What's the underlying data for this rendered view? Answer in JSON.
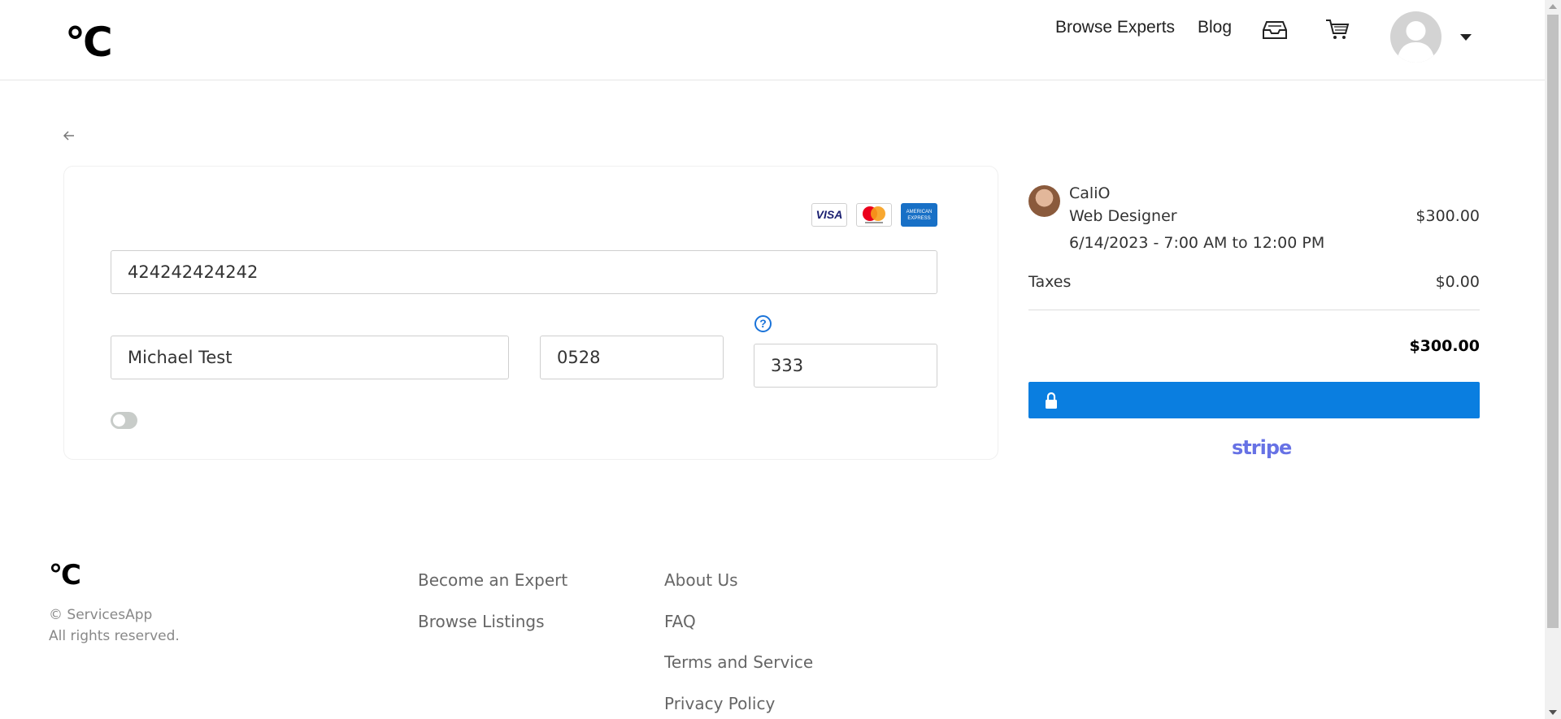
{
  "header": {
    "logo": "°C",
    "nav": {
      "browse_experts": "Browse Experts",
      "blog": "Blog"
    }
  },
  "payment": {
    "card_brands": {
      "visa": "VISA",
      "amex": "AMERICAN EXPRESS"
    },
    "card_number": "424242424242",
    "card_name": "Michael Test",
    "expiry": "0528",
    "cvc": "333",
    "help_symbol": "?"
  },
  "summary": {
    "expert_name": "CaliO",
    "role": "Web Designer",
    "price": "$300.00",
    "schedule": "6/14/2023 - 7:00 AM to 12:00 PM",
    "taxes_label": "Taxes",
    "taxes_value": "$0.00",
    "total": "$300.00",
    "powered_by": "stripe"
  },
  "footer": {
    "logo": "°C",
    "copyright_line1": "© ServicesApp",
    "copyright_line2": "All rights reserved.",
    "links_col1": [
      "Become an Expert",
      "Browse Listings"
    ],
    "links_col2": [
      "About Us",
      "FAQ",
      "Terms and Service",
      "Privacy Policy"
    ]
  },
  "colors": {
    "primary_button": "#0a7ee0",
    "stripe": "#6772e5",
    "help": "#1a73d9"
  }
}
